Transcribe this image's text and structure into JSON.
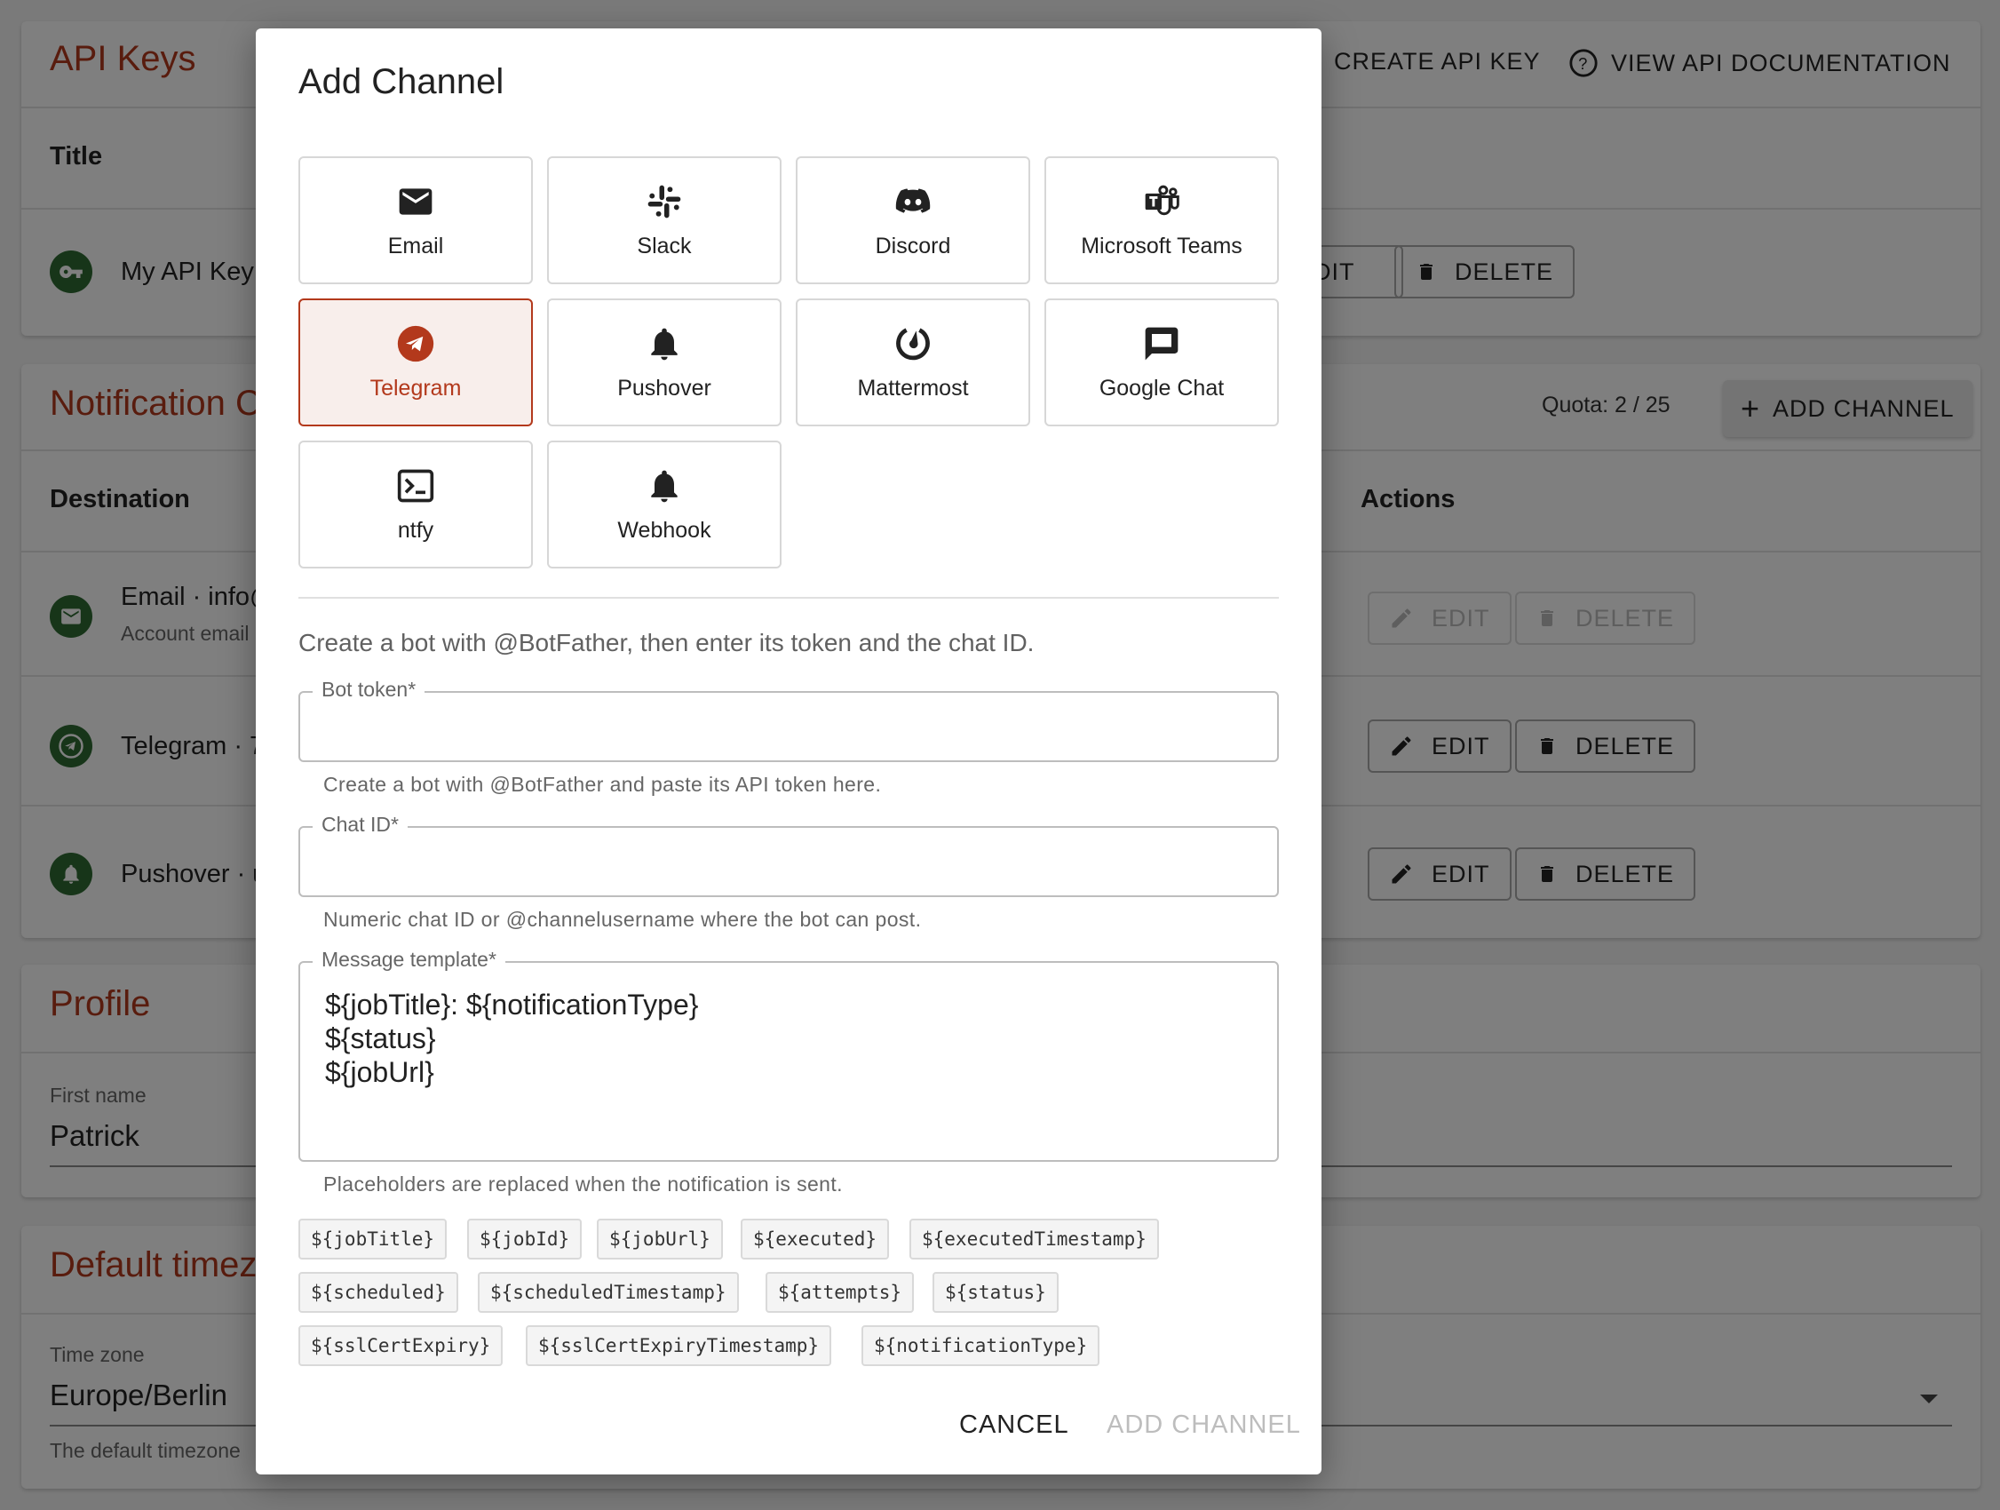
{
  "api_keys": {
    "title": "API Keys",
    "create_label": "CREATE API KEY",
    "docs_label": "VIEW API DOCUMENTATION",
    "col_title": "Title",
    "row_name": "My API Key",
    "edit_label": "EDIT",
    "delete_label": "DELETE"
  },
  "notifications": {
    "title": "Notification Channels",
    "quota": "Quota: 2 / 25",
    "add_label": "ADD CHANNEL",
    "col_destination": "Destination",
    "col_actions": "Actions",
    "rows": [
      {
        "text": "Email · info@",
        "sub": "Account email",
        "edit": "EDIT",
        "delete": "DELETE"
      },
      {
        "text": "Telegram · 7",
        "sub": "",
        "edit": "EDIT",
        "delete": "DELETE"
      },
      {
        "text": "Pushover · u",
        "sub": "",
        "edit": "EDIT",
        "delete": "DELETE"
      }
    ]
  },
  "profile": {
    "title": "Profile",
    "first_name_label": "First name",
    "first_name_value": "Patrick"
  },
  "timezone": {
    "title": "Default timezone",
    "label": "Time zone",
    "value": "Europe/Berlin",
    "helper": "The default timezone"
  },
  "dialog": {
    "title": "Add Channel",
    "channels": [
      {
        "label": "Email",
        "icon": "email-icon"
      },
      {
        "label": "Slack",
        "icon": "slack-icon"
      },
      {
        "label": "Discord",
        "icon": "discord-icon"
      },
      {
        "label": "Microsoft Teams",
        "icon": "teams-icon"
      },
      {
        "label": "Telegram",
        "icon": "telegram-icon",
        "selected": true
      },
      {
        "label": "Pushover",
        "icon": "bell-icon"
      },
      {
        "label": "Mattermost",
        "icon": "mattermost-icon"
      },
      {
        "label": "Google Chat",
        "icon": "chat-icon"
      },
      {
        "label": "ntfy",
        "icon": "terminal-icon"
      },
      {
        "label": "Webhook",
        "icon": "bell-icon"
      }
    ],
    "intro": "Create a bot with @BotFather, then enter its token and the chat ID.",
    "bot_token": {
      "label": "Bot token",
      "required": "*",
      "value": "",
      "helper": "Create a bot with @BotFather and paste its API token here."
    },
    "chat_id": {
      "label": "Chat ID",
      "required": "*",
      "value": "",
      "helper": "Numeric chat ID or @channelusername where the bot can post."
    },
    "template": {
      "label": "Message template",
      "required": "*",
      "value": "${jobTitle}: ${notificationType}\n${status}\n${jobUrl}",
      "helper": "Placeholders are replaced when the notification is sent."
    },
    "placeholders": [
      "${jobTitle}",
      "${jobId}",
      "${jobUrl}",
      "${executed}",
      "${executedTimestamp}",
      "${scheduled}",
      "${scheduledTimestamp}",
      "${attempts}",
      "${status}",
      "${sslCertExpiry}",
      "${sslCertExpiryTimestamp}",
      "${notificationType}"
    ],
    "cancel_label": "CANCEL",
    "submit_label": "ADD CHANNEL"
  },
  "colors": {
    "accent": "#b3391c",
    "avatar_green": "#2e6b32"
  }
}
